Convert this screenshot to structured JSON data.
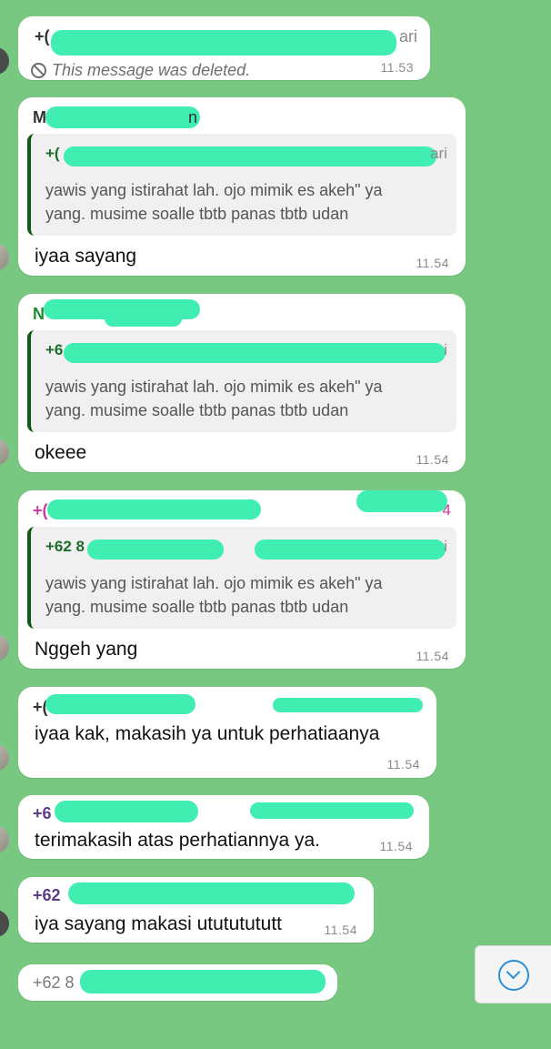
{
  "colors": {
    "chat_background": "#79c882",
    "bubble": "#ffffff",
    "redaction": "#40eeb2",
    "quote_bar": "#0f5a1b",
    "timestamp": "#8a8a8a"
  },
  "messages": [
    {
      "sender_visible": "+(",
      "sender_suffix": "ari",
      "deleted_text": "This message was deleted.",
      "time": "11.53"
    },
    {
      "sender_visible": "M",
      "sender_suffix": "n",
      "quote": {
        "sender_visible": "+(",
        "sender_suffix": "ari",
        "line1": "yawis yang istirahat lah. ojo mimik es akeh\" ya",
        "line2": "yang. musime soalle tbtb panas tbtb udan"
      },
      "text": "iyaa sayang",
      "time": "11.54"
    },
    {
      "sender_visible": "N",
      "quote": {
        "sender_visible": "+6",
        "sender_suffix": "i",
        "line1": "yawis yang istirahat lah. ojo mimik es akeh\" ya",
        "line2": "yang. musime soalle tbtb panas tbtb udan"
      },
      "text": "okeee",
      "time": "11.54"
    },
    {
      "sender_visible": "+(",
      "sender_suffix": "4",
      "quote": {
        "sender_visible": "+62 8",
        "sender_suffix": "i",
        "line1": "yawis yang istirahat lah. ojo mimik es akeh\" ya",
        "line2": "yang. musime soalle tbtb panas tbtb udan"
      },
      "text": "Nggeh yang",
      "time": "11.54"
    },
    {
      "sender_visible": "+(",
      "text": "iyaa kak, makasih ya untuk perhatiaanya",
      "time": "11.54"
    },
    {
      "sender_visible": "+6",
      "text": "terimakasih atas perhatiannya ya.",
      "time": "11.54"
    },
    {
      "sender_visible": "+62",
      "text": "iya sayang makasi utututututt",
      "time": "11.54"
    },
    {
      "sender_visible": "+62 8"
    }
  ],
  "scroll_down_button": {
    "icon": "chevron-down-circle-icon"
  }
}
